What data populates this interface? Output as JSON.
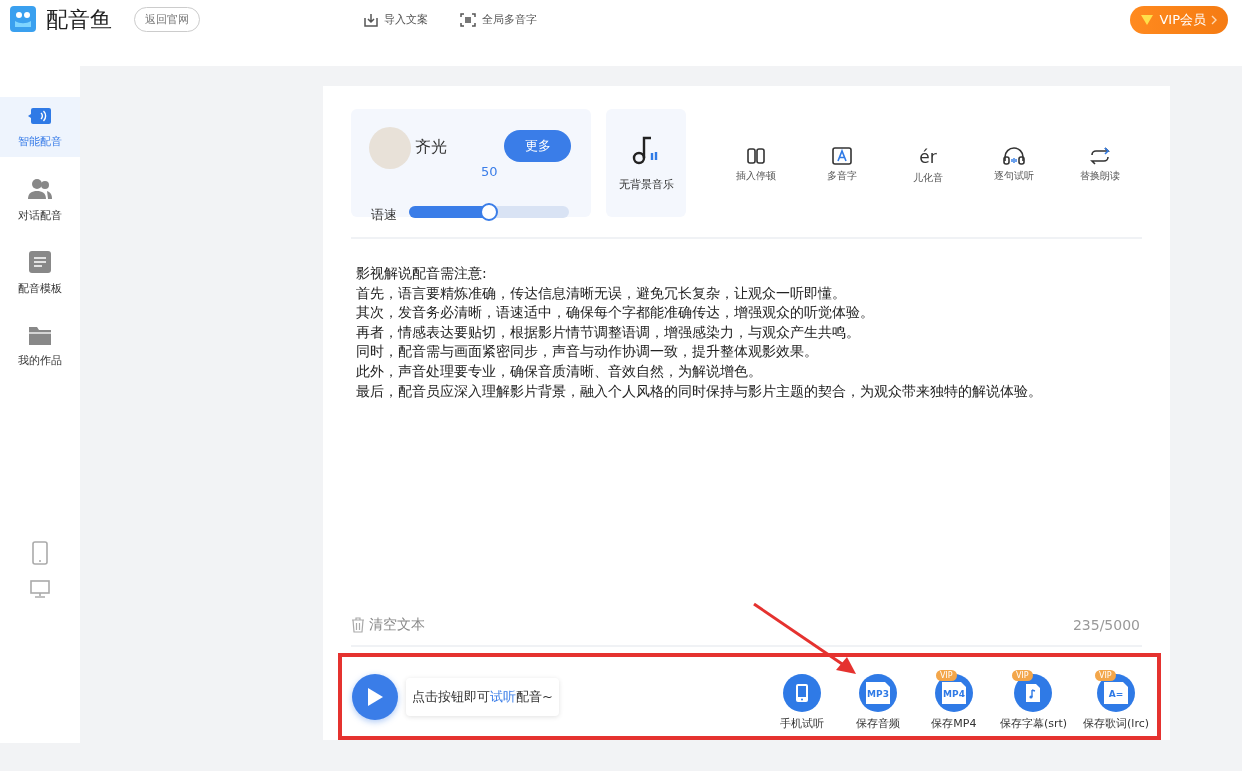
{
  "header": {
    "app_name": "配音鱼",
    "back_button": "返回官网",
    "actions": [
      {
        "kind": "import",
        "label": "导入文案"
      },
      {
        "kind": "scan",
        "label": "全局多音字"
      }
    ],
    "vip_button": "VIP会员"
  },
  "sidebar": {
    "items": [
      {
        "kind": "voice",
        "label": "智能配音",
        "selected": true
      },
      {
        "kind": "dialog",
        "label": "对话配音",
        "selected": false
      },
      {
        "kind": "template",
        "label": "配音模板",
        "selected": false
      },
      {
        "kind": "works",
        "label": "我的作品",
        "selected": false
      }
    ]
  },
  "voice": {
    "name": "齐光",
    "more_button": "更多",
    "speed_value": "50",
    "speed_label": "语速",
    "level": 0.5
  },
  "bgm": {
    "label": "无背景音乐"
  },
  "tools": [
    {
      "kind": "pause",
      "label": "插入停顿"
    },
    {
      "kind": "poly",
      "label": "多音字"
    },
    {
      "kind": "er",
      "icon_text": "ér",
      "label": "儿化音"
    },
    {
      "kind": "listen",
      "label": "逐句试听"
    },
    {
      "kind": "replace",
      "label": "替换朗读"
    }
  ],
  "text_lines": [
    "影视解说配音需注意:",
    "首先，语言要精炼准确，传达信息清晰无误，避免冗长复杂，让观众一听即懂。",
    "其次，发音务必清晰，语速适中，确保每个字都能准确传达，增强观众的听觉体验。",
    "再者，情感表达要贴切，根据影片情节调整语调，增强感染力，与观众产生共鸣。",
    "同时，配音需与画面紧密同步，声音与动作协调一致，提升整体观影效果。",
    "此外，声音处理要专业，确保音质清晰、音效自然，为解说增色。",
    "最后，配音员应深入理解影片背景，融入个人风格的同时保持与影片主题的契合，为观众带来独特的解说体验。"
  ],
  "clear_button": "清空文本",
  "char_count": "235/5000",
  "bottom": {
    "hint_before": "点击按钮即可",
    "hint_link": "试听",
    "hint_after": "配音~",
    "actions": [
      {
        "kind": "phone",
        "label": "手机试听"
      },
      {
        "kind": "mp3",
        "icon_text": "MP3",
        "label": "保存音频"
      },
      {
        "kind": "mp4",
        "icon_text": "MP4",
        "label": "保存MP4",
        "badge": "VIP"
      },
      {
        "kind": "srt",
        "label": "保存字幕(srt)",
        "badge": "VIP"
      },
      {
        "kind": "lrc",
        "icon_text": "A=",
        "label": "保存歌词(lrc)",
        "badge": "VIP"
      }
    ]
  }
}
